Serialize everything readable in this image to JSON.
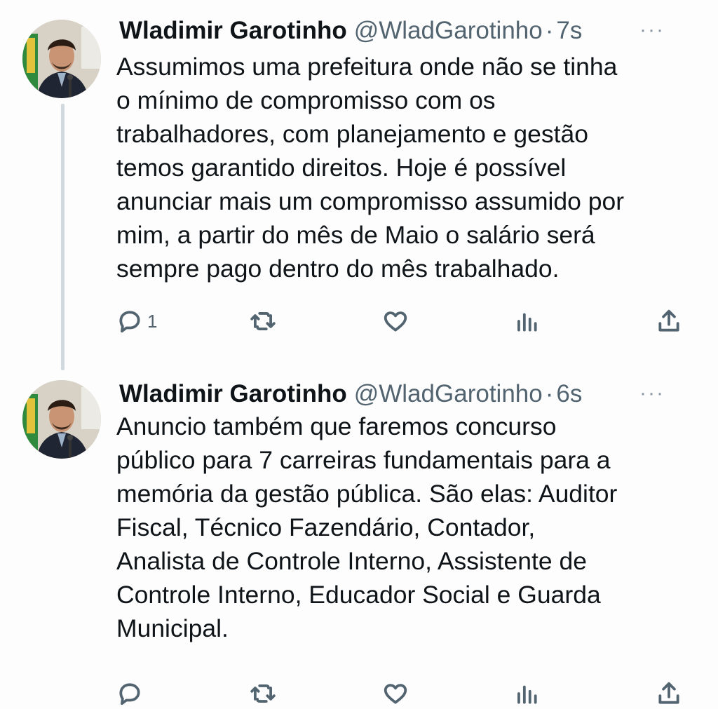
{
  "tweets": [
    {
      "author_name": "Wladimir Garotinho",
      "handle": "@WladGarotinho",
      "separator": "·",
      "time": "7s",
      "more": "···",
      "text": "Assumimos uma prefeitura onde não se tinha\no mínimo de compromisso com os\ntrabalhadores, com planejamento e gestão\ntemos garantido direitos. Hoje é possível\nanunciar mais um compromisso assumido por\nmim, a partir do mês de Maio o salário será\nsempre pago dentro do mês trabalhado.",
      "reply_count": "1",
      "icons": [
        "reply-icon",
        "retweet-icon",
        "like-icon",
        "views-icon",
        "share-icon"
      ]
    },
    {
      "author_name": "Wladimir Garotinho",
      "handle": "@WladGarotinho",
      "separator": "·",
      "time": "6s",
      "more": "···",
      "text": "Anuncio também que faremos concurso\npúblico para 7 carreiras fundamentais para a\nmemória da gestão pública. São elas: Auditor\nFiscal, Técnico Fazendário, Contador,\nAnalista de Controle Interno, Assistente de\nControle Interno, Educador Social e Guarda\nMunicipal.",
      "reply_count": "",
      "icons": [
        "reply-icon",
        "retweet-icon",
        "like-icon",
        "views-icon",
        "share-icon"
      ]
    }
  ],
  "colors": {
    "text": "#0f1419",
    "secondary": "#536471",
    "thread_line": "#cfd9de",
    "background": "#fdfdfd"
  }
}
